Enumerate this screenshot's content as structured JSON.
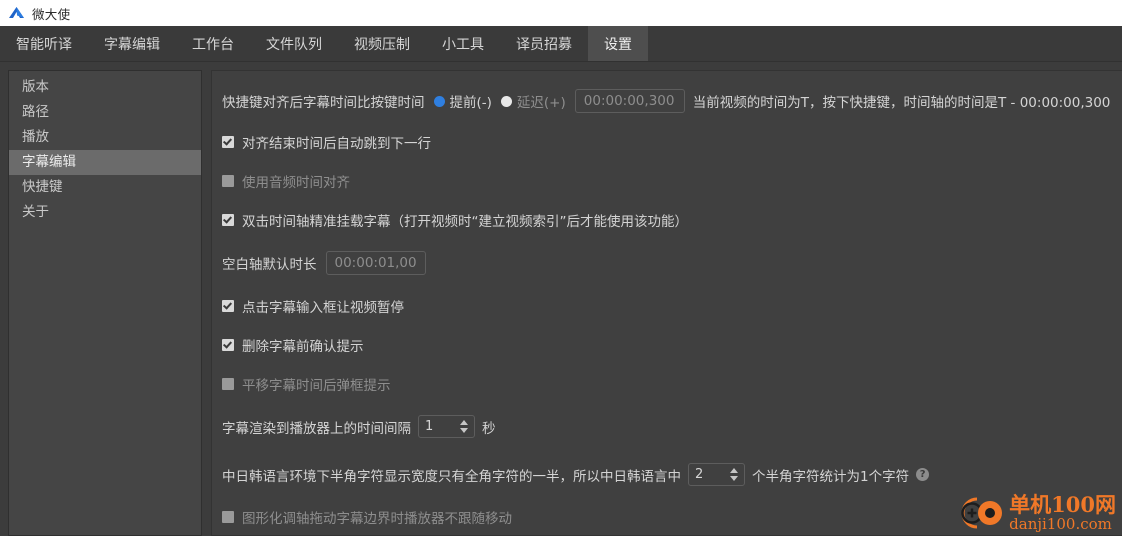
{
  "window": {
    "title": "微大使",
    "logo_icon": "blue-arrow-logo"
  },
  "tabs": [
    {
      "label": "智能听译",
      "active": false
    },
    {
      "label": "字幕编辑",
      "active": false
    },
    {
      "label": "工作台",
      "active": false
    },
    {
      "label": "文件队列",
      "active": false
    },
    {
      "label": "视频压制",
      "active": false
    },
    {
      "label": "小工具",
      "active": false
    },
    {
      "label": "译员招募",
      "active": false
    },
    {
      "label": "设置",
      "active": true
    }
  ],
  "sidebar": {
    "items": [
      {
        "label": "版本",
        "active": false
      },
      {
        "label": "路径",
        "active": false
      },
      {
        "label": "播放",
        "active": false
      },
      {
        "label": "字幕编辑",
        "active": true
      },
      {
        "label": "快捷键",
        "active": false
      },
      {
        "label": "关于",
        "active": false
      }
    ]
  },
  "settings": {
    "align_offset": {
      "label": "快捷键对齐后字幕时间比按键时间",
      "radio_before": "提前(-)",
      "radio_after": "延迟(+)",
      "selected": "提前(-)",
      "value": "00:00:00,300",
      "hint": "当前视频的时间为T，按下快捷键，时间轴的时间是T - 00:00:00,300"
    },
    "checkbox_auto_next": {
      "label": "对齐结束时间后自动跳到下一行",
      "checked": true
    },
    "checkbox_audio_align": {
      "label": "使用音频时间对齐",
      "checked": false
    },
    "checkbox_dblclick_mount": {
      "label": "双击时间轴精准挂载字幕（打开视频时“建立视频索引”后才能使用该功能）",
      "checked": true
    },
    "blank_axis": {
      "label": "空白轴默认时长",
      "value": "00:00:01,000"
    },
    "checkbox_click_pause": {
      "label": "点击字幕输入框让视频暂停",
      "checked": true
    },
    "checkbox_delete_confirm": {
      "label": "删除字幕前确认提示",
      "checked": true
    },
    "checkbox_shift_dialog": {
      "label": "平移字幕时间后弹框提示",
      "checked": false
    },
    "render_interval": {
      "label": "字幕渲染到播放器上的时间间隔",
      "value": "1",
      "unit": "秒"
    },
    "cjk_width": {
      "label_prefix": "中日韩语言环境下半角字符显示宽度只有全角字符的一半，所以中日韩语言中",
      "value": "2",
      "label_suffix": "个半角字符统计为1个字符",
      "help": "?"
    },
    "checkbox_drag_no_follow": {
      "label": "图形化调轴拖动字幕边界时播放器不跟随移动",
      "checked": false
    }
  },
  "watermark": {
    "title": "单机100网",
    "domain": "danji100.com",
    "color": "#f07828"
  }
}
